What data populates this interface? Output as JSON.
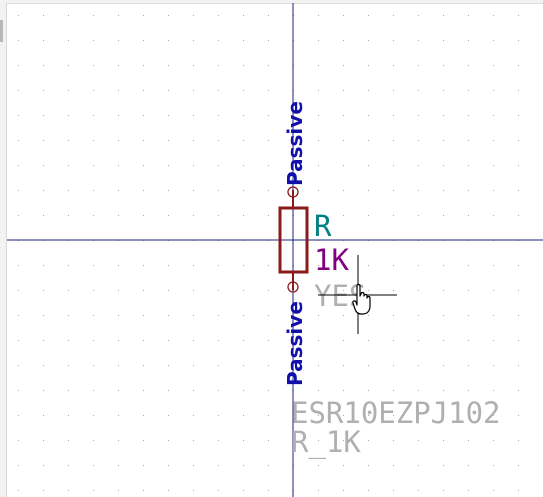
{
  "schematic": {
    "component": {
      "reference": "R",
      "value": "1K",
      "field_yes": "YES",
      "part_number": "ESR10EZPJ102",
      "footprint": "R_1K",
      "pin_top_type": "Passive",
      "pin_bottom_type": "Passive"
    },
    "colors": {
      "background": "#ffffff",
      "grid_dot": "#a8a8a8",
      "axis_line": "#1a237e",
      "body_outline": "#8b1a1a",
      "pin_line": "#8b1a1a",
      "pin_type_text": "#1111aa",
      "reference_text": "#008080",
      "value_text": "#800080",
      "field_text": "#b0b0b0",
      "cursor": "#000000"
    },
    "cursor_icon": "hand-pointer-icon"
  }
}
